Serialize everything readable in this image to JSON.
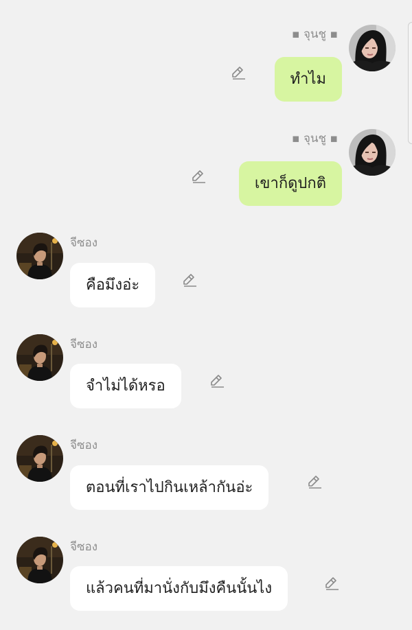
{
  "messages": [
    {
      "id": "m1",
      "direction": "out",
      "sender": "▪ จุนชู ▪",
      "text": "ทำไม",
      "avatar": "dark-hair-portrait"
    },
    {
      "id": "m2",
      "direction": "out",
      "sender": "▪ จุนชู ▪",
      "text": "เขาก็ดูปกติ",
      "avatar": "dark-hair-portrait"
    },
    {
      "id": "m3",
      "direction": "in",
      "sender": "จีซอง",
      "text": "คือมึงอ่ะ",
      "avatar": "night-street-portrait"
    },
    {
      "id": "m4",
      "direction": "in",
      "sender": "จีซอง",
      "text": "จำไม่ได้หรอ",
      "avatar": "night-street-portrait"
    },
    {
      "id": "m5",
      "direction": "in",
      "sender": "จีซอง",
      "text": "ตอนที่เราไปกินเหล้ากันอ่ะ",
      "avatar": "night-street-portrait"
    },
    {
      "id": "m6",
      "direction": "in",
      "sender": "จีซอง",
      "text": "แล้วคนที่มานั่งกับมึงคืนนั้นไง",
      "avatar": "night-street-portrait"
    }
  ],
  "icons": {
    "edit": "pencil-icon"
  },
  "colors": {
    "background": "#f1f1f1",
    "outgoing_bubble": "#d7f5a1",
    "incoming_bubble": "#ffffff",
    "sender_name": "#8d8d8d"
  }
}
